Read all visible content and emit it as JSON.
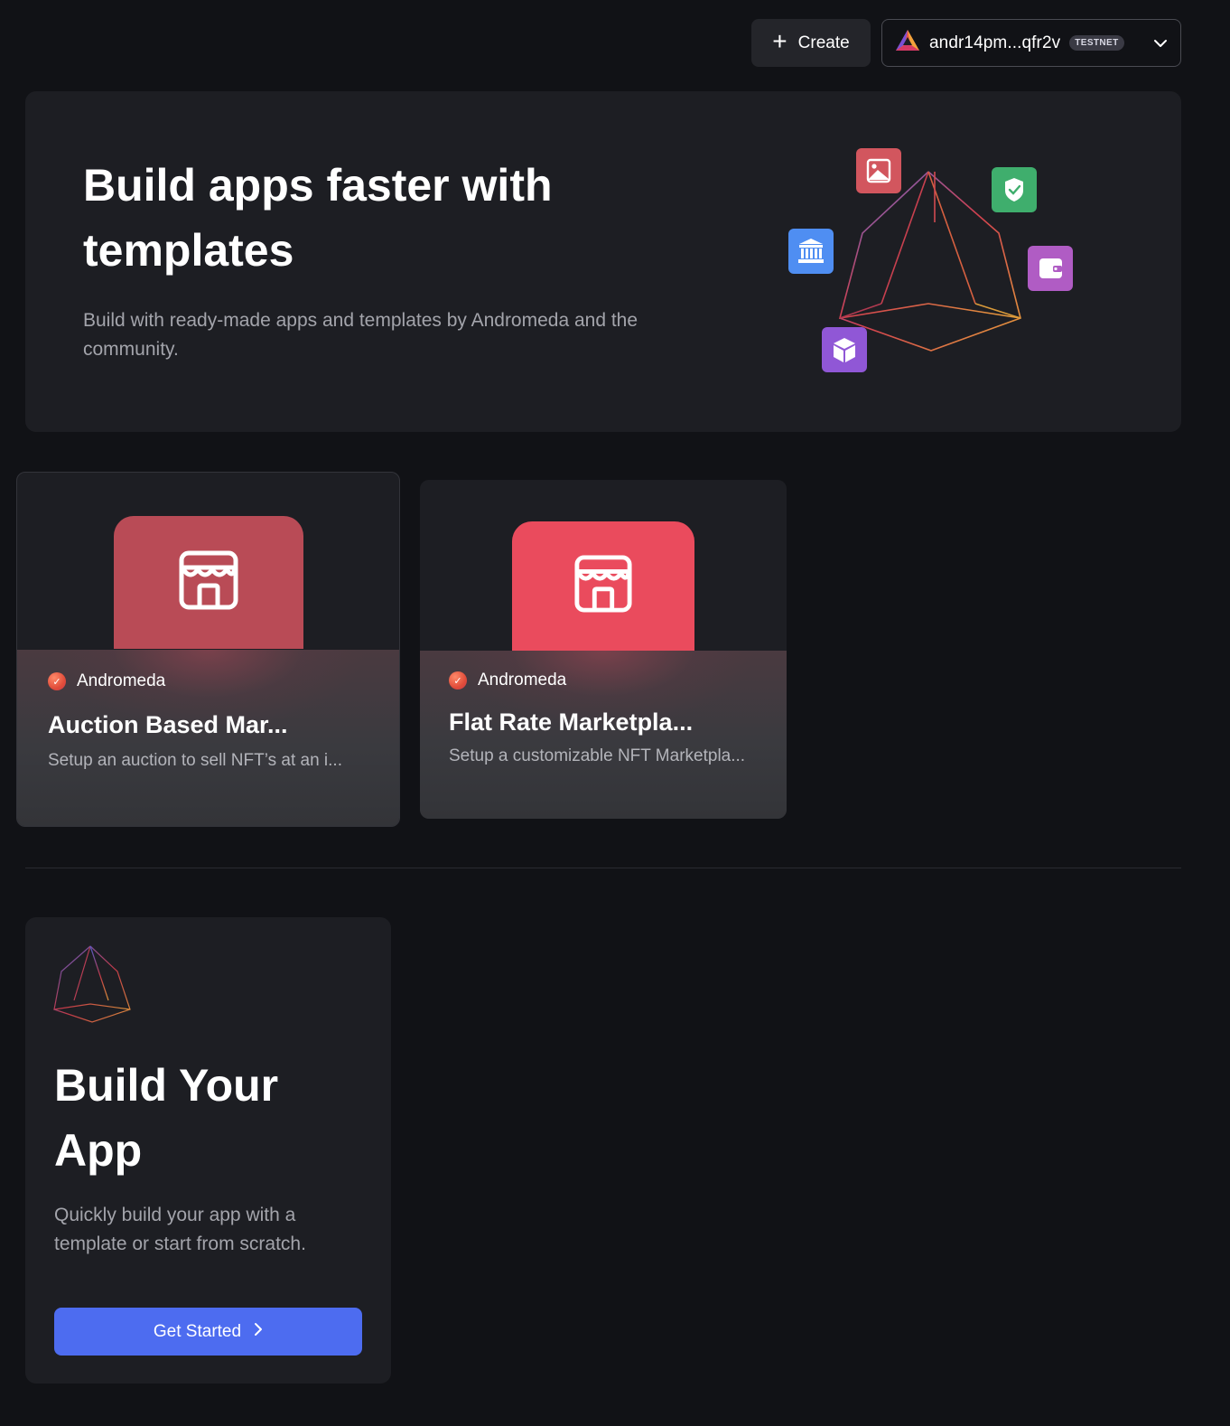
{
  "header": {
    "create_label": "Create",
    "wallet_address": "andr14pm...qfr2v",
    "network_badge": "TESTNET"
  },
  "hero": {
    "title": "Build apps faster with templates",
    "subtitle": "Build with ready-made apps and templates by Andromeda and the community.",
    "icons": [
      "image-icon",
      "shield-icon",
      "bank-icon",
      "wallet-icon",
      "cube-icon"
    ]
  },
  "templates": [
    {
      "publisher": "Andromeda",
      "title": "Auction Based Mar...",
      "description": "Setup an auction to sell NFT’s at an i...",
      "color": "#b94b56",
      "icon": "storefront-icon"
    },
    {
      "publisher": "Andromeda",
      "title": "Flat Rate Marketpla...",
      "description": "Setup a customizable NFT Marketpla...",
      "color": "#ea4b5d",
      "icon": "storefront-icon"
    }
  ],
  "build": {
    "title": "Build Your App",
    "description": "Quickly build your app with a template or start from scratch.",
    "cta_label": "Get Started"
  },
  "colors": {
    "background": "#111216",
    "panel": "#1d1e23",
    "accent": "#4d6cf0"
  }
}
